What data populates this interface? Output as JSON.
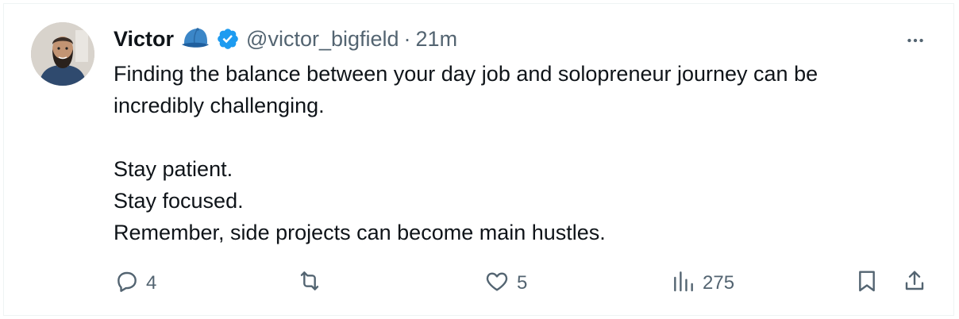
{
  "tweet": {
    "author": {
      "name": "Victor",
      "handle": "@victor_bigfield",
      "separator": "·",
      "time": "21m",
      "badges": [
        "blue-cap-icon",
        "verified-badge-icon"
      ]
    },
    "text": {
      "line1": "Finding the balance between your day job and solopreneur journey can be",
      "line2": "incredibly challenging.",
      "line3": "",
      "line4": "Stay patient.",
      "line5": "Stay focused.",
      "line6": "Remember, side projects can become main hustles."
    },
    "metrics": {
      "replies": "4",
      "reposts": "",
      "likes": "5",
      "views": "275"
    },
    "icons": {
      "reply": "reply-icon",
      "repost": "repost-icon",
      "like": "heart-icon",
      "views": "analytics-icon",
      "bookmark": "bookmark-icon",
      "share": "share-icon",
      "more": "more-dots-icon"
    },
    "colors": {
      "text_primary": "#0f1419",
      "text_secondary": "#536471",
      "verified": "#1d9bf0",
      "border": "#eff3f4"
    }
  }
}
